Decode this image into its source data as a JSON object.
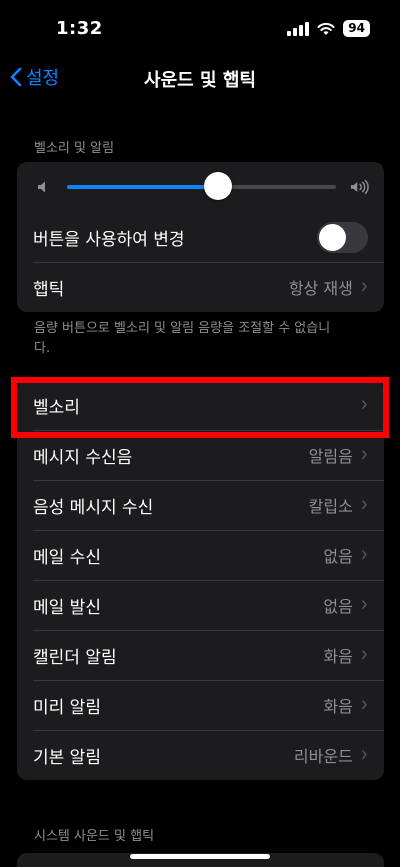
{
  "status": {
    "time": "1:32",
    "battery": "94"
  },
  "nav": {
    "back_label": "설정",
    "title": "사운드 및 햅틱"
  },
  "ringer_section": {
    "header": "벨소리 및 알림",
    "volume_level": 0.56,
    "change_with_buttons_label": "버튼을 사용하여 변경",
    "change_with_buttons_on": false,
    "haptics_label": "햅틱",
    "haptics_value": "항상 재생",
    "footer": "음량 버튼으로 벨소리 및 알림 음량을 조절할 수 없습니다."
  },
  "sounds": [
    {
      "label": "벨소리",
      "value": ""
    },
    {
      "label": "메시지 수신음",
      "value": "알림음"
    },
    {
      "label": "음성 메시지 수신",
      "value": "칼립소"
    },
    {
      "label": "메일 수신",
      "value": "없음"
    },
    {
      "label": "메일 발신",
      "value": "없음"
    },
    {
      "label": "캘린더 알림",
      "value": "화음"
    },
    {
      "label": "미리 알림",
      "value": "화음"
    },
    {
      "label": "기본 알림",
      "value": "리바운드"
    }
  ],
  "system_section": {
    "header": "시스템 사운드 및 햅틱"
  },
  "colors": {
    "accent": "#0a84ff",
    "highlight": "#ff0000",
    "cell_background": "#1c1c1e"
  }
}
